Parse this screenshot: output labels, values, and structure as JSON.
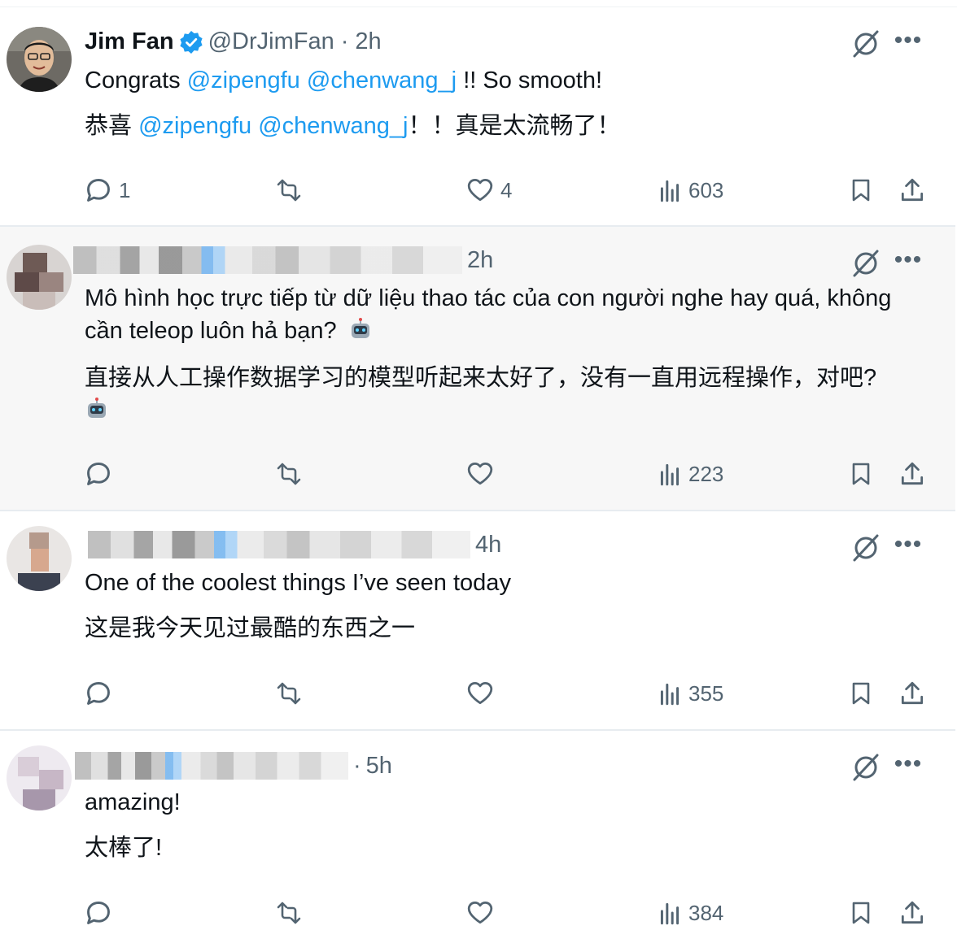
{
  "tweets": [
    {
      "name": "Jim Fan",
      "handle": "@DrJimFan",
      "dot": "·",
      "time": "2h",
      "line1_prefix": "Congrats",
      "mention1": "@zipengfu",
      "mention2": "@chenwang_j",
      "line1_suffix": "!! So smooth!",
      "line2_prefix": "恭喜",
      "line2_suffix": "！！真是太流畅了！",
      "replies": "1",
      "likes": "4",
      "views": "603"
    },
    {
      "time": "2h",
      "text1": "Mô hình học trực tiếp từ dữ liệu thao tác của con người nghe hay quá, không cần teleop luôn hả bạn?",
      "text2": "直接从人工操作数据学习的模型听起来太好了，没有一直用远程操作，对吧?",
      "views": "223"
    },
    {
      "time": "4h",
      "text1": "One of the coolest things I’ve seen today",
      "text2": "这是我今天见过最酷的东西之一",
      "views": "355"
    },
    {
      "time": "5h",
      "text1": "amazing!",
      "text2": "太棒了!",
      "views": "384"
    }
  ],
  "icons": {
    "reply": "reply-icon",
    "retweet": "retweet-icon",
    "like": "heart-icon",
    "views": "views-icon",
    "bookmark": "bookmark-icon",
    "share": "share-icon",
    "grok": "grok-icon",
    "more": "more-icon",
    "verified": "verified-badge-icon",
    "robot": "robot-emoji-icon"
  },
  "colors": {
    "accent": "#1d9bf0",
    "secondary_text": "#536471",
    "highlight_bg": "#f7f7f7"
  }
}
